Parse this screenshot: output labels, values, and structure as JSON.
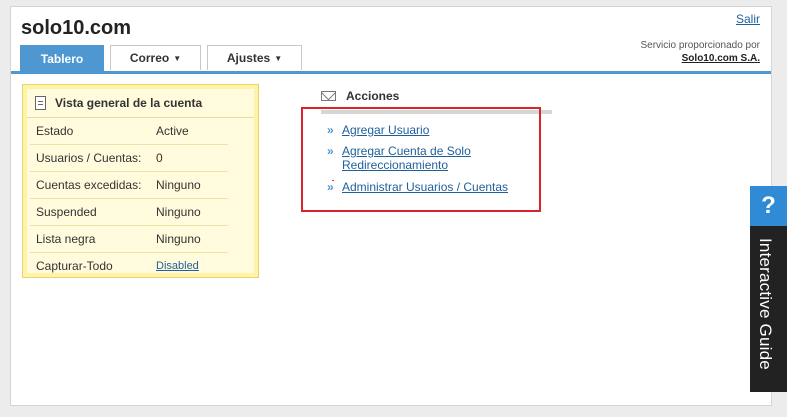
{
  "header": {
    "site_title": "solo10.com",
    "logout_label": "Salir",
    "provider_line": "Servicio proporcionado por",
    "provider_company": "Solo10.com S.A."
  },
  "tabs": [
    {
      "label": "Tablero",
      "active": true,
      "has_dropdown": false
    },
    {
      "label": "Correo",
      "active": false,
      "has_dropdown": true
    },
    {
      "label": "Ajustes",
      "active": false,
      "has_dropdown": true
    }
  ],
  "overview": {
    "title": "Vista general de la cuenta",
    "icon": "document-icon",
    "rows": [
      {
        "label": "Estado",
        "value": "Active"
      },
      {
        "label": "Usuarios / Cuentas:",
        "value": "0"
      },
      {
        "label": "Cuentas excedidas:",
        "value": "Ninguno"
      },
      {
        "label": "Suspended",
        "value": "Ninguno"
      },
      {
        "label": "Lista negra",
        "value": "Ninguno"
      },
      {
        "label": "Capturar-Todo",
        "value": "Disabled"
      }
    ]
  },
  "actions": {
    "title": "Acciones",
    "icon": "mail-icon",
    "bullet": "»",
    "items": [
      {
        "label": "Agregar Usuario"
      },
      {
        "label": "Agregar Cuenta de Solo Redireccionamiento"
      },
      {
        "label": "Administrar Usuarios / Cuentas"
      }
    ]
  },
  "guide": {
    "icon_text": "?",
    "label": "Interactive Guide"
  },
  "colors": {
    "accent": "#4f97d1",
    "link": "#1f5f9c",
    "highlight_box": "#d9232d",
    "overview_bg": "#fdf4a8",
    "guide_bg": "#222222"
  }
}
